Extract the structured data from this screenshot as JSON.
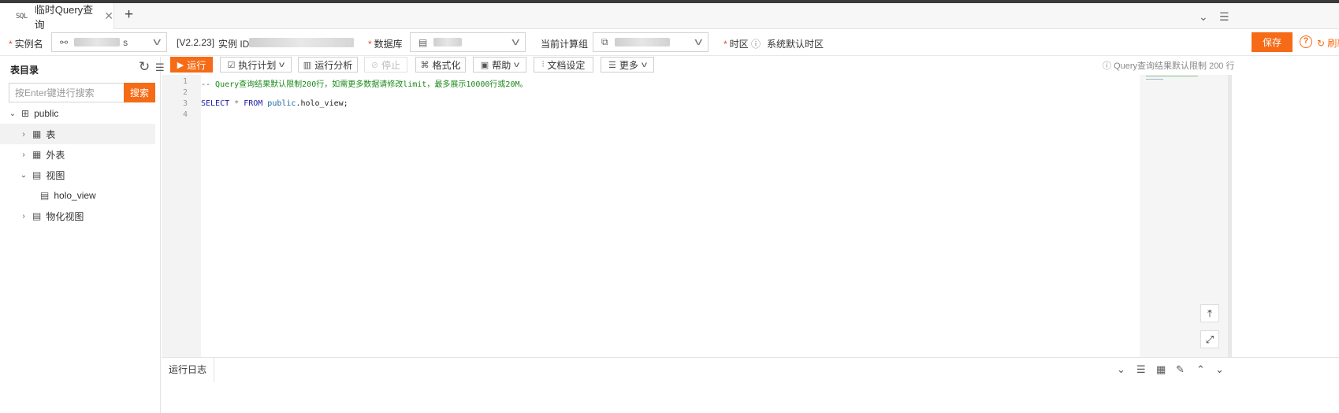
{
  "tab": {
    "icon_text": "SQL",
    "label": "临时Query查询",
    "close": "✕",
    "add": "+"
  },
  "config": {
    "required_mark": "*",
    "instance_label": "实例名",
    "instance_value_suffix": "s",
    "version": "[V2.2.23]",
    "instance_id_label": "实例 ID",
    "database_label": "数据库",
    "compute_group_label": "当前计算组",
    "timezone_label": "时区",
    "timezone_value": "系统默认时区",
    "save": "保存",
    "refresh": "刷新"
  },
  "sidebar": {
    "title": "表目录",
    "search_placeholder": "按Enter键进行搜索",
    "search_button": "搜索",
    "tree": [
      {
        "label": "public",
        "icon": "schema-icon",
        "expanded": true
      },
      {
        "label": "表",
        "icon": "table-icon",
        "expanded": false,
        "selected": true
      },
      {
        "label": "外表",
        "icon": "external-table-icon",
        "expanded": false
      },
      {
        "label": "视图",
        "icon": "view-icon",
        "expanded": true
      },
      {
        "label": "holo_view",
        "icon": "view-icon"
      },
      {
        "label": "物化视图",
        "icon": "materialized-view-icon",
        "expanded": false
      }
    ]
  },
  "toolbar": {
    "run": "运行",
    "plan": "执行计划",
    "analyze": "运行分析",
    "stop": "停止",
    "format": "格式化",
    "help": "帮助",
    "doc_settings": "文档设定",
    "more": "更多",
    "limit_note": "Query查询结果默认限制 200 行"
  },
  "editor": {
    "line_numbers": [
      "1",
      "2",
      "3",
      "4"
    ],
    "comment": "-- Query查询结果默认限制200行，如需更多数据请修改limit，最多展示10000行或20M。",
    "select_kw": "SELECT",
    "star": " * ",
    "from_kw": "FROM",
    "schema": " public",
    "object": ".holo_view;"
  },
  "bottom": {
    "tab": "运行日志"
  },
  "colors": {
    "accent": "#f56b16",
    "comment": "#1a8a1a",
    "keyword": "#1a1aa6"
  }
}
